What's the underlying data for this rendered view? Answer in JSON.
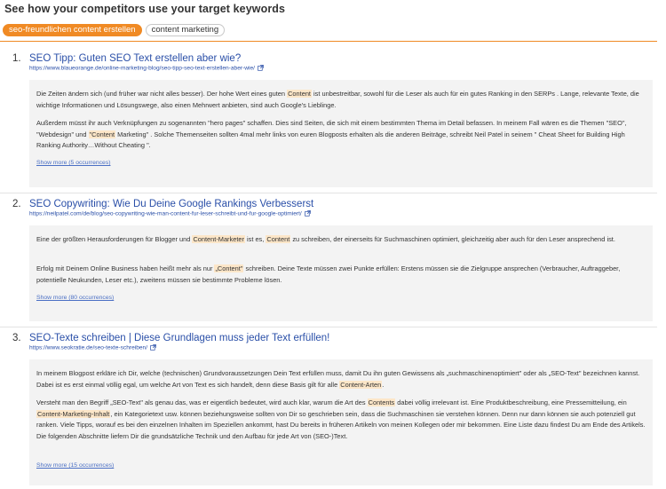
{
  "header": {
    "title": "See how your competitors use your target keywords"
  },
  "keywords": [
    {
      "label": "seo-freundlichen content erstellen",
      "active": true
    },
    {
      "label": "content marketing",
      "active": false
    }
  ],
  "results": [
    {
      "number": "1.",
      "title": "SEO Tipp: Guten SEO Text erstellen aber wie?",
      "url": "https://www.blaueorange.de/online-marketing-blog/seo-tipp-seo-text-erstellen-aber-wie/",
      "paragraphs": [
        [
          {
            "t": "Die Zeiten ändern sich (und früher war nicht alles besser). Der hohe Wert eines guten "
          },
          {
            "t": "Content",
            "h": true
          },
          {
            "t": " ist unbestreitbar, sowohl für die Leser als auch für ein gutes Ranking in den SERPs . Lange, relevante Texte, die wichtige Informationen und Lösungswege, also einen Mehrwert anbieten, sind auch Google's Lieblinge."
          }
        ],
        [
          {
            "t": "Außerdem müsst ihr auch Verknüpfungen zu sogenannten \"hero pages\" schaffen. Dies sind Seiten, die sich mit einem bestimmten Thema im Detail befassen. In meinem Fall wären es die Themen \"SEO\", \"Webdesign\" und "
          },
          {
            "t": "\"Content",
            "h": true
          },
          {
            "t": " Marketing\" . Solche Themenseiten sollten 4mal mehr links von euren Blogposts erhalten als die anderen Beiträge, schreibt Neil Patel in seinem \" Cheat Sheet for Building High Ranking Authority…Without Cheating \"."
          }
        ]
      ],
      "show_more": "Show more (5 occurrences)"
    },
    {
      "number": "2.",
      "title": "SEO Copywriting: Wie Du Deine Google Rankings Verbesserst",
      "url": "https://neilpatel.com/de/blog/seo-copywriting-wie-man-content-fur-leser-schreibt-und-fur-google-optimiert/",
      "paragraphs": [
        [
          {
            "t": "Eine der größten Herausforderungen für Blogger und "
          },
          {
            "t": "Content-Marketer",
            "h": true
          },
          {
            "t": " ist es, "
          },
          {
            "t": "Content",
            "h": true
          },
          {
            "t": " zu schreiben, der einerseits für Suchmaschinen optimiert, gleichzeitig aber auch für den Leser ansprechend ist."
          }
        ],
        [
          {
            "t": "Erfolg mit Deinem Online Business haben heißt mehr als nur "
          },
          {
            "t": "„Content\"",
            "h": true
          },
          {
            "t": " schreiben. Deine Texte müssen zwei Punkte erfüllen: Erstens müssen sie die Zielgruppe ansprechen (Verbraucher, Auftraggeber, potentielle Neukunden, Leser etc.), zweitens müssen sie bestimmte Probleme lösen."
          }
        ]
      ],
      "show_more": "Show more (80 occurrences)"
    },
    {
      "number": "3.",
      "title": "SEO-Texte schreiben | Diese Grundlagen muss jeder Text erfüllen!",
      "url": "https://www.seokratie.de/seo-texte-schreiben/",
      "paragraphs": [
        [
          {
            "t": "In meinem Blogpost erkläre ich Dir, welche (technischen) Grundvoraussetzungen Dein Text erfüllen muss, damit Du ihn guten Gewissens als „suchmaschinenoptimiert\" oder als „SEO-Text\" bezeichnen kannst. Dabei ist es erst einmal völlig egal, um welche Art von Text es sich handelt, denn diese Basis gilt für alle "
          },
          {
            "t": "Content-Arten",
            "h": true
          },
          {
            "t": "."
          }
        ],
        [
          {
            "t": "Versteht man den Begriff „SEO-Text\" als genau das, was er eigentlich bedeutet, wird auch klar, warum die Art des "
          },
          {
            "t": "Contents",
            "h": true
          },
          {
            "t": " dabei völlig irrelevant ist. Eine Produktbeschreibung, eine Pressemitteilung, ein "
          },
          {
            "t": "Content-Marketing-Inhalt",
            "h": true
          },
          {
            "t": ", ein Kategorietext usw. können beziehungsweise sollten von Dir so geschrieben sein, dass die Suchmaschinen sie verstehen können. Denn nur dann können sie auch potenziell gut ranken. Viele Tipps, worauf es bei den einzelnen Inhalten im Speziellen ankommt, hast Du bereits in früheren Artikeln von meinen Kollegen oder mir bekommen. Eine Liste dazu findest Du am Ende des Artikels. Die folgenden Abschnitte liefern Dir die grundsätzliche Technik und den Aufbau für jede Art von (SEO-)Text."
          }
        ]
      ],
      "show_more": "Show more (15 occurrences)"
    }
  ],
  "icons": {
    "external_link": "external-link-icon"
  },
  "colors": {
    "accent": "#f08a24",
    "link": "#2a4fa8",
    "highlight": "#fce6c8",
    "snippet_bg": "#f3f3f3"
  }
}
